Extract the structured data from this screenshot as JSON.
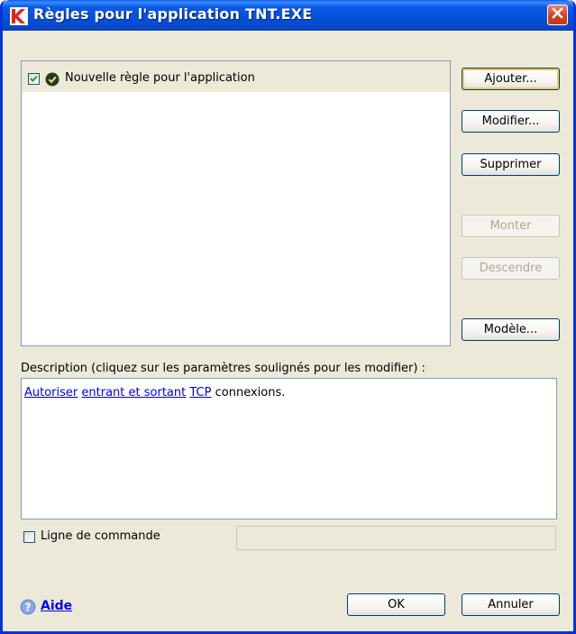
{
  "window": {
    "title": "Règles pour l'application TNT.EXE"
  },
  "rules": {
    "items": [
      {
        "label": "Nouvelle règle pour l'application",
        "checked": true,
        "status_icon": "check-circle-icon"
      }
    ]
  },
  "buttons": {
    "add": "Ajouter...",
    "edit": "Modifier...",
    "delete": "Supprimer",
    "up": "Monter",
    "down": "Descendre",
    "template": "Modèle..."
  },
  "description": {
    "label": "Description (cliquez sur les paramètres soulignés pour les modifier) :",
    "allow": "Autoriser",
    "direction": "entrant et sortant",
    "protocol": "TCP",
    "suffix": "connexions."
  },
  "command_line": {
    "label": "Ligne de commande",
    "checked": false,
    "value": ""
  },
  "footer": {
    "help": "Aide",
    "ok": "OK",
    "cancel": "Annuler"
  },
  "colors": {
    "titlebar": "#0451d8",
    "window_bg": "#ece9d8",
    "link": "#0000ee",
    "close": "#d1421f"
  }
}
